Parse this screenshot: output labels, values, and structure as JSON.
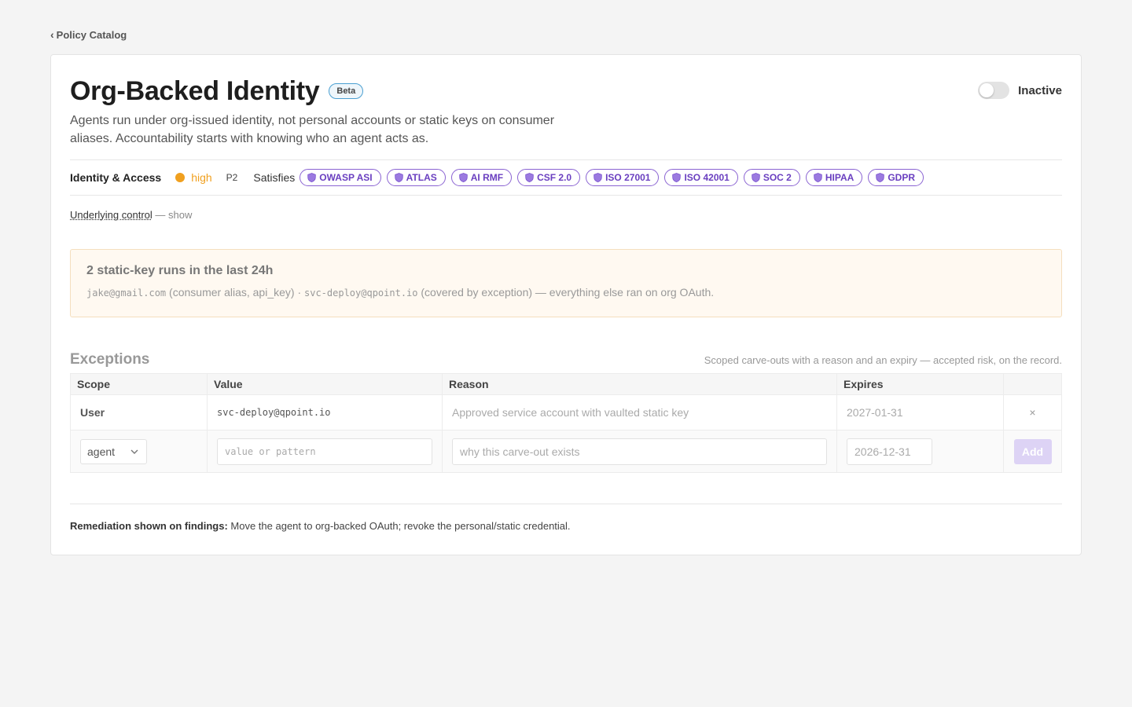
{
  "back": {
    "label": "Policy Catalog"
  },
  "policy": {
    "title": "Org-Backed Identity",
    "badge": "Beta",
    "status_label": "Inactive",
    "enabled": false,
    "description": "Agents run under org-issued identity, not personal accounts or static keys on consumer aliases. Accountability starts with knowing who an agent acts as."
  },
  "meta": {
    "category": "Identity & Access",
    "severity": "high",
    "severity_color": "#f0a01f",
    "priority": "P2",
    "satisfies_label": "Satisfies",
    "frameworks": [
      "OWASP ASI",
      "ATLAS",
      "AI RMF",
      "CSF 2.0",
      "ISO 27001",
      "ISO 42001",
      "SOC 2",
      "HIPAA",
      "GDPR"
    ],
    "framework_icon": "shield-icon",
    "framework_color": "#6a3fc0"
  },
  "underlying": {
    "link": "Underlying control",
    "suffix": " — show"
  },
  "alert": {
    "title": "2 static-key runs in the last 24h",
    "item1_id": "jake@gmail.com",
    "item1_note": " (consumer alias, api_key) · ",
    "item2_id": "svc-deploy@qpoint.io",
    "item2_note": " (covered by exception) — everything else ran on org OAuth."
  },
  "exceptions": {
    "title": "Exceptions",
    "subtitle": "Scoped carve-outs with a reason and an expiry — accepted risk, on the record.",
    "columns": [
      "Scope",
      "Value",
      "Reason",
      "Expires",
      ""
    ],
    "rows": [
      {
        "scope": "User",
        "value": "svc-deploy@qpoint.io",
        "reason": "Approved service account with vaulted static key",
        "expires": "2027-01-31",
        "remove": "×"
      }
    ],
    "new_row": {
      "scope": "agent",
      "value_placeholder": "value or pattern",
      "reason_placeholder": "why this carve-out exists",
      "expires": "2026-12-31",
      "add_label": "Add"
    }
  },
  "remediation": {
    "label": "Remediation shown on findings:",
    "text": " Move the agent to org-backed OAuth; revoke the personal/static credential."
  }
}
